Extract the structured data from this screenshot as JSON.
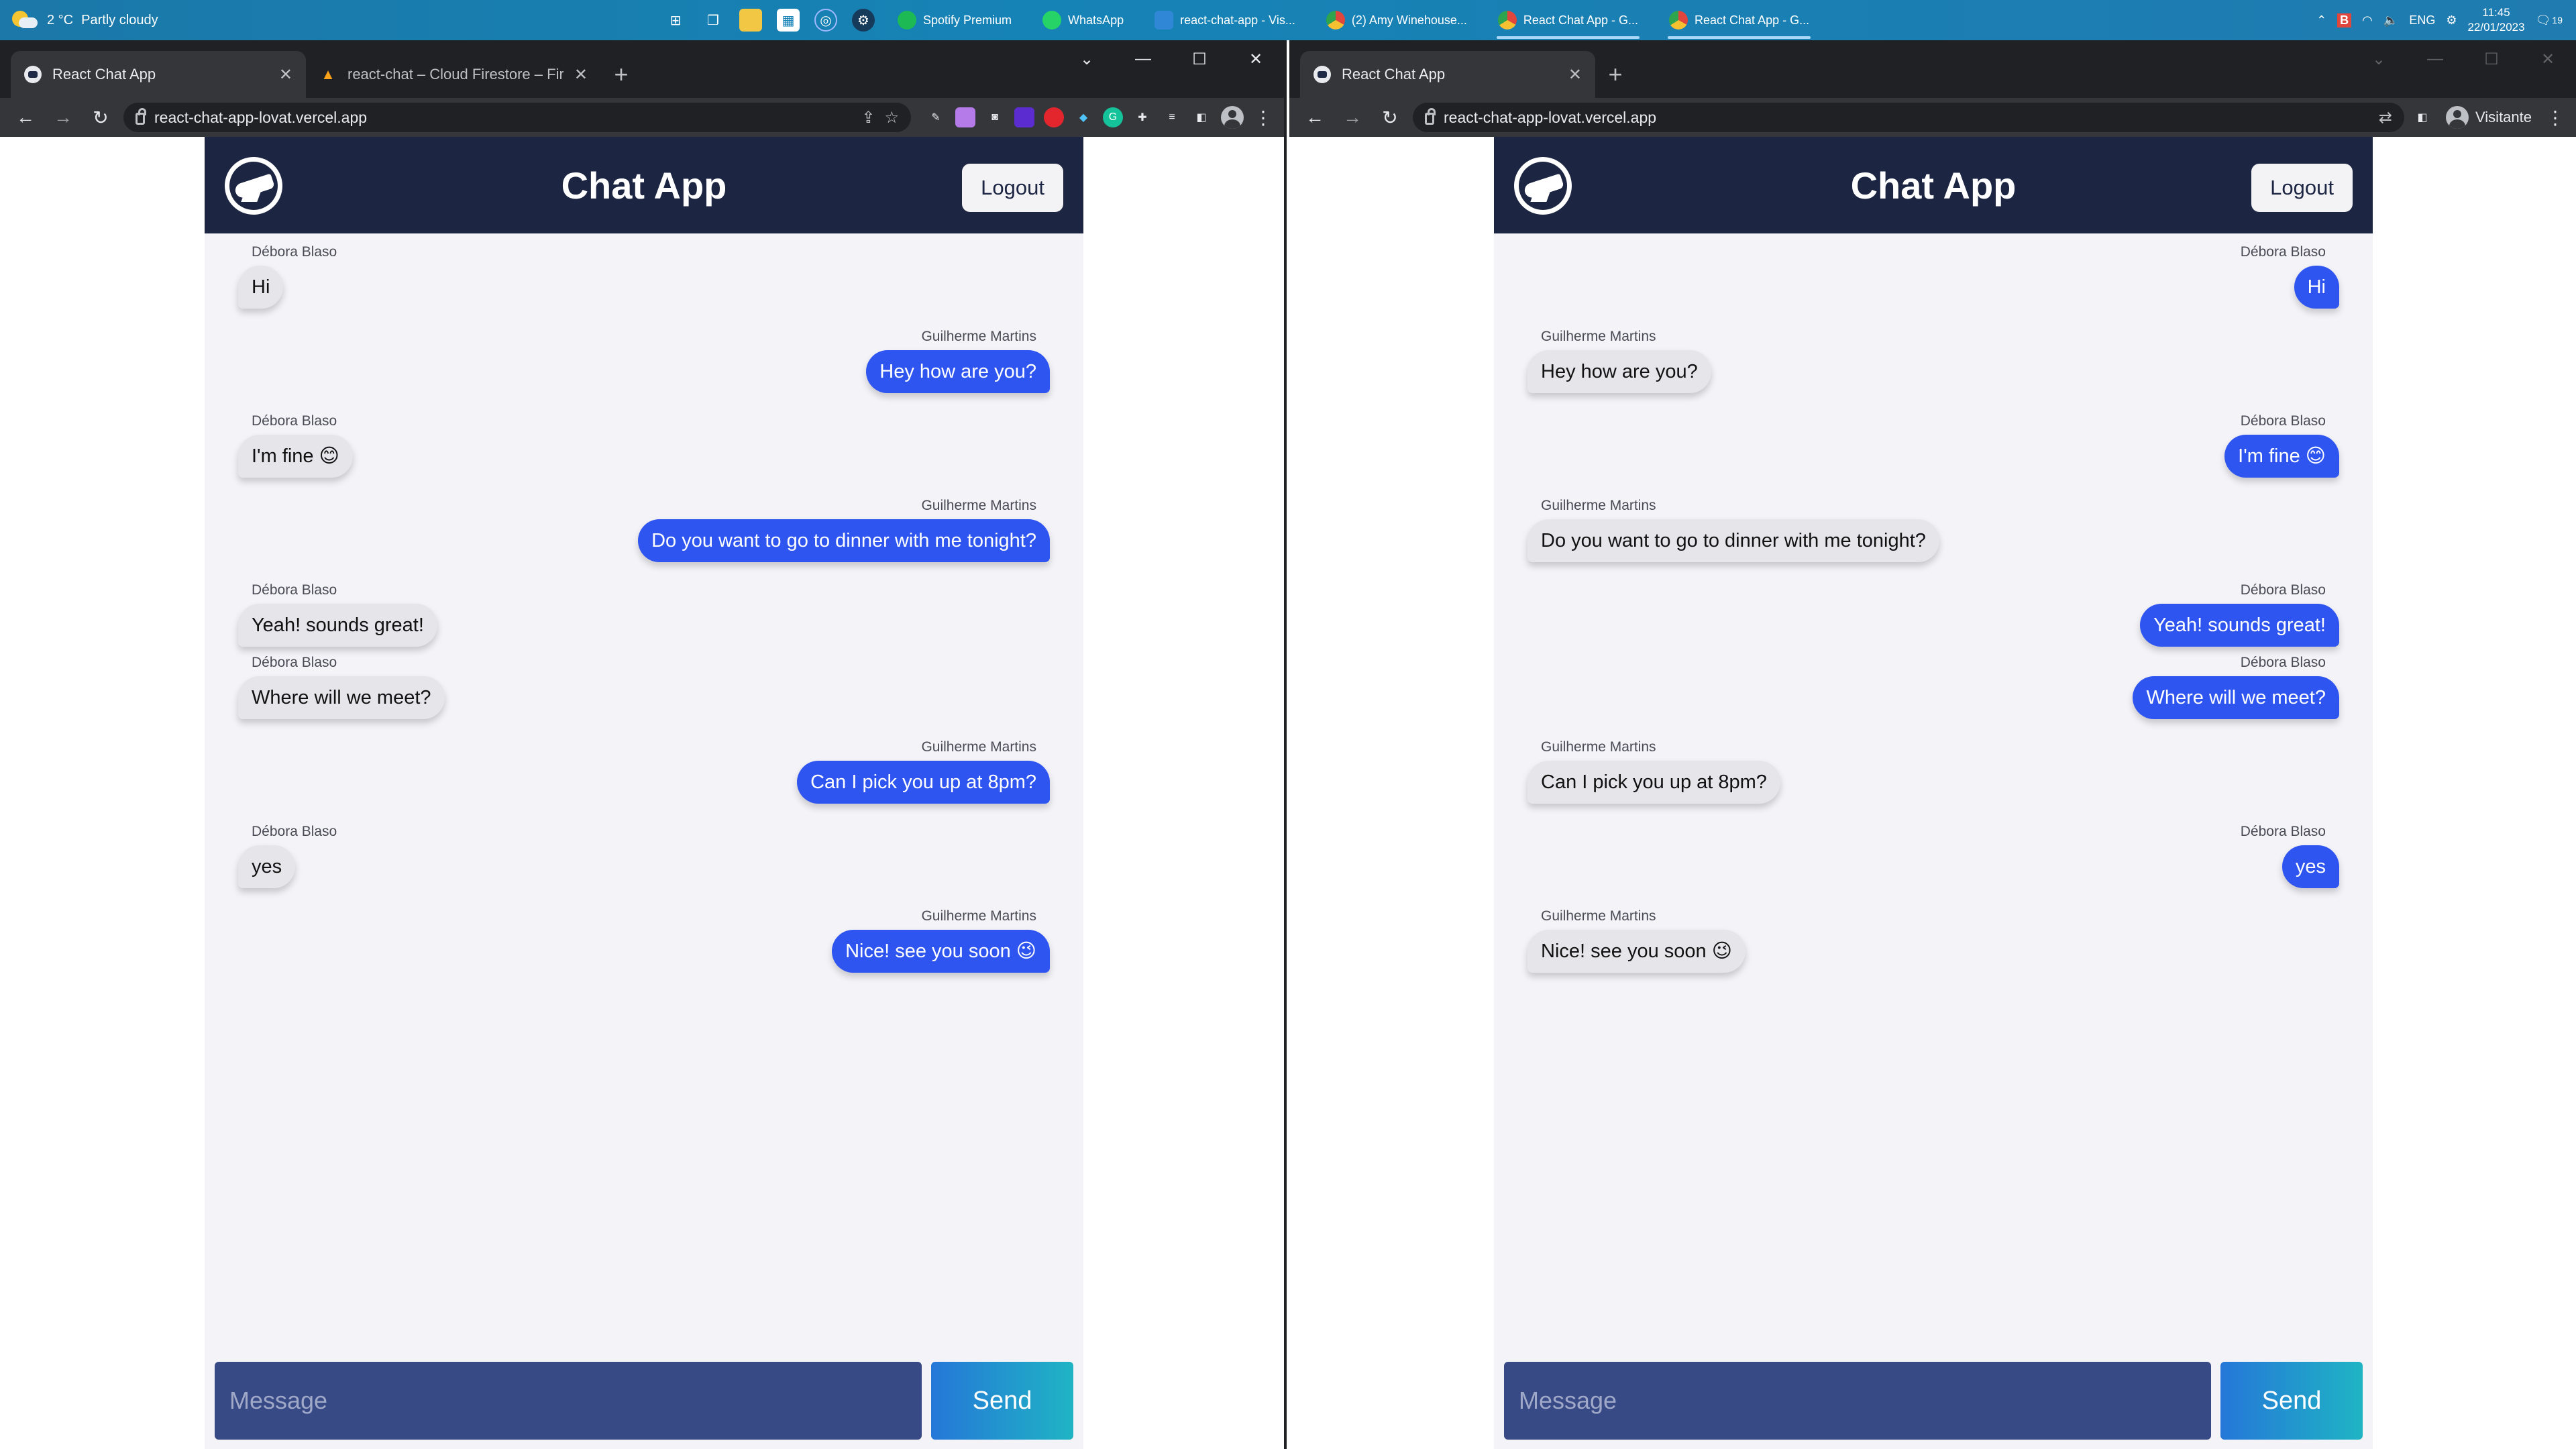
{
  "taskbar": {
    "weather_temp": "2 °C",
    "weather_text": "Partly cloudy",
    "apps": [
      {
        "label": "Spotify Premium",
        "color": "#1db954"
      },
      {
        "label": "WhatsApp",
        "color": "#25d366"
      },
      {
        "label": "react-chat-app - Vis...",
        "color": "#2f87d6"
      },
      {
        "label": "(2) Amy Winehouse...",
        "color": "#e0463b"
      },
      {
        "label": "React Chat App - G...",
        "color": "#e0463b"
      },
      {
        "label": "React Chat App - G...",
        "color": "#e0463b"
      }
    ],
    "lang": "ENG",
    "time": "11:45",
    "date": "22/01/2023",
    "notification_count": "19"
  },
  "left_window": {
    "tabs": [
      {
        "title": "React Chat App",
        "active": true
      },
      {
        "title": "react-chat – Cloud Firestore – Fir",
        "active": false
      }
    ],
    "url": "react-chat-app-lovat.vercel.app"
  },
  "right_window": {
    "tabs": [
      {
        "title": "React Chat App",
        "active": true
      }
    ],
    "url": "react-chat-app-lovat.vercel.app",
    "profile_label": "Visitante"
  },
  "chat": {
    "title": "Chat App",
    "logout_label": "Logout",
    "input_placeholder": "Message",
    "send_label": "Send",
    "colors": {
      "header_bg": "#1c2541",
      "own_bubble": "#2f55f0",
      "other_bubble": "#e5e5ea",
      "app_bg": "#f3f3f8"
    },
    "messages": [
      {
        "author": "Débora Blaso",
        "text": "Hi"
      },
      {
        "author": "Guilherme Martins",
        "text": "Hey how are you?"
      },
      {
        "author": "Débora Blaso",
        "text": "I'm fine 😊"
      },
      {
        "author": "Guilherme Martins",
        "text": "Do you want to go to dinner with me tonight?"
      },
      {
        "author": "Débora Blaso",
        "text": "Yeah! sounds great!"
      },
      {
        "author": "Débora Blaso",
        "text": "Where will we meet?"
      },
      {
        "author": "Guilherme Martins",
        "text": "Can I pick you up at 8pm?"
      },
      {
        "author": "Débora Blaso",
        "text": "yes"
      },
      {
        "author": "Guilherme Martins",
        "text": "Nice! see you soon 😉"
      }
    ]
  }
}
